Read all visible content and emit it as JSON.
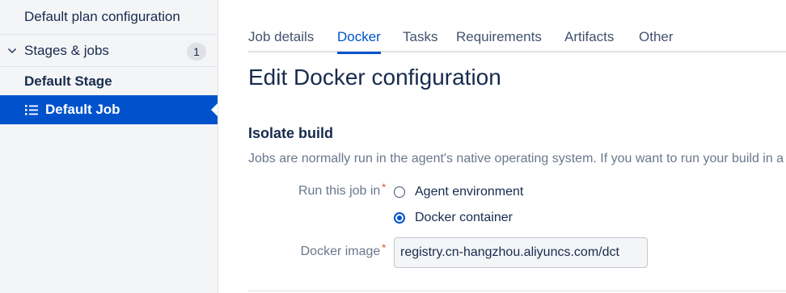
{
  "sidebar": {
    "plan_config": "Default plan configuration",
    "stages_jobs": "Stages & jobs",
    "stages_count": "1",
    "stage": "Default Stage",
    "job": "Default Job"
  },
  "tabs": [
    "Job details",
    "Docker",
    "Tasks",
    "Requirements",
    "Artifacts",
    "Other"
  ],
  "active_tab": "Docker",
  "main": {
    "title": "Edit Docker configuration",
    "section_title": "Isolate build",
    "description": "Jobs are normally run in the agent's native operating system. If you want to run your build in a Docker container",
    "run_label": "Run this job in",
    "required_mark": "*",
    "options": [
      "Agent environment",
      "Docker container"
    ],
    "selected_option": "Docker container",
    "image_label": "Docker image",
    "image_value": "registry.cn-hangzhou.aliyuncs.com/dct"
  },
  "colors": {
    "accent": "#0052cc",
    "sidebar_bg": "#f4f5f7",
    "required": "#de350b"
  }
}
